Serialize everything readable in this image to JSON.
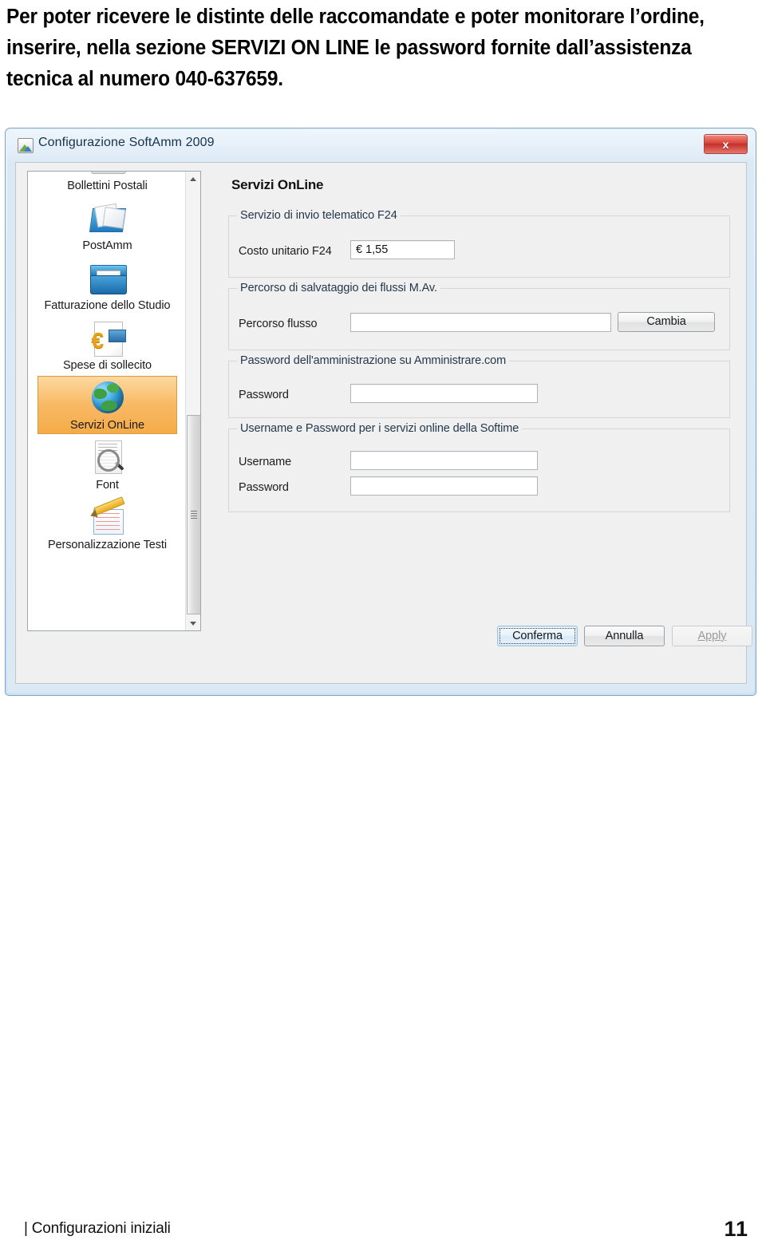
{
  "document": {
    "intro_paragraph": "Per poter ricevere le distinte delle raccomandate e poter monitorare l’ordine, inserire, nella sezione SERVIZI ON LINE le password fornite dall’assistenza tecnica al numero 040-637659.",
    "footer_left_bar": "|",
    "footer_left": "Configurazioni iniziali",
    "footer_page_number": "11"
  },
  "dialog": {
    "title": "Configurazione SoftAmm 2009",
    "title_icon": "app-picture-icon",
    "close_label": "x",
    "sidebar": {
      "scroll_up_icon": "scroll-up-arrow-icon",
      "scroll_down_icon": "scroll-down-arrow-icon",
      "items": [
        {
          "label": "Bollettini Postali",
          "icon": "printer-icon",
          "selected": false
        },
        {
          "label": "PostAmm",
          "icon": "mail-envelopes-icon",
          "selected": false
        },
        {
          "label": "Fatturazione dello Studio",
          "icon": "invoice-box-icon",
          "selected": false
        },
        {
          "label": "Spese di sollecito",
          "icon": "euro-document-icon",
          "selected": false
        },
        {
          "label": "Servizi OnLine",
          "icon": "globe-icon",
          "selected": true
        },
        {
          "label": "Font",
          "icon": "document-magnifier-icon",
          "selected": false
        },
        {
          "label": "Personalizzazione Testi",
          "icon": "notepad-pencil-icon",
          "selected": false
        }
      ]
    },
    "panel": {
      "title": "Servizi OnLine",
      "groups": [
        {
          "caption": "Servizio di invio telematico F24",
          "fields": [
            {
              "label": "Costo unitario F24",
              "value": "€ 1,55"
            }
          ]
        },
        {
          "caption": "Percorso di salvataggio dei flussi M.Av.",
          "fields": [
            {
              "label": "Percorso flusso",
              "value": ""
            }
          ],
          "button": "Cambia"
        },
        {
          "caption": "Password dell'amministrazione su Amministrare.com",
          "fields": [
            {
              "label": "Password",
              "value": ""
            }
          ]
        },
        {
          "caption": "Username e Password per i servizi online della Softime",
          "fields": [
            {
              "label": "Username",
              "value": ""
            },
            {
              "label": "Password",
              "value": ""
            }
          ]
        }
      ]
    },
    "buttons": {
      "confirm": "Conferma",
      "cancel": "Annulla",
      "apply": "Apply",
      "apply_enabled": false
    },
    "colors": {
      "selection": "#f8b964",
      "titlebar": "#dceaf5",
      "close_button": "#d9453a",
      "client_background": "#f0f0f0"
    }
  }
}
